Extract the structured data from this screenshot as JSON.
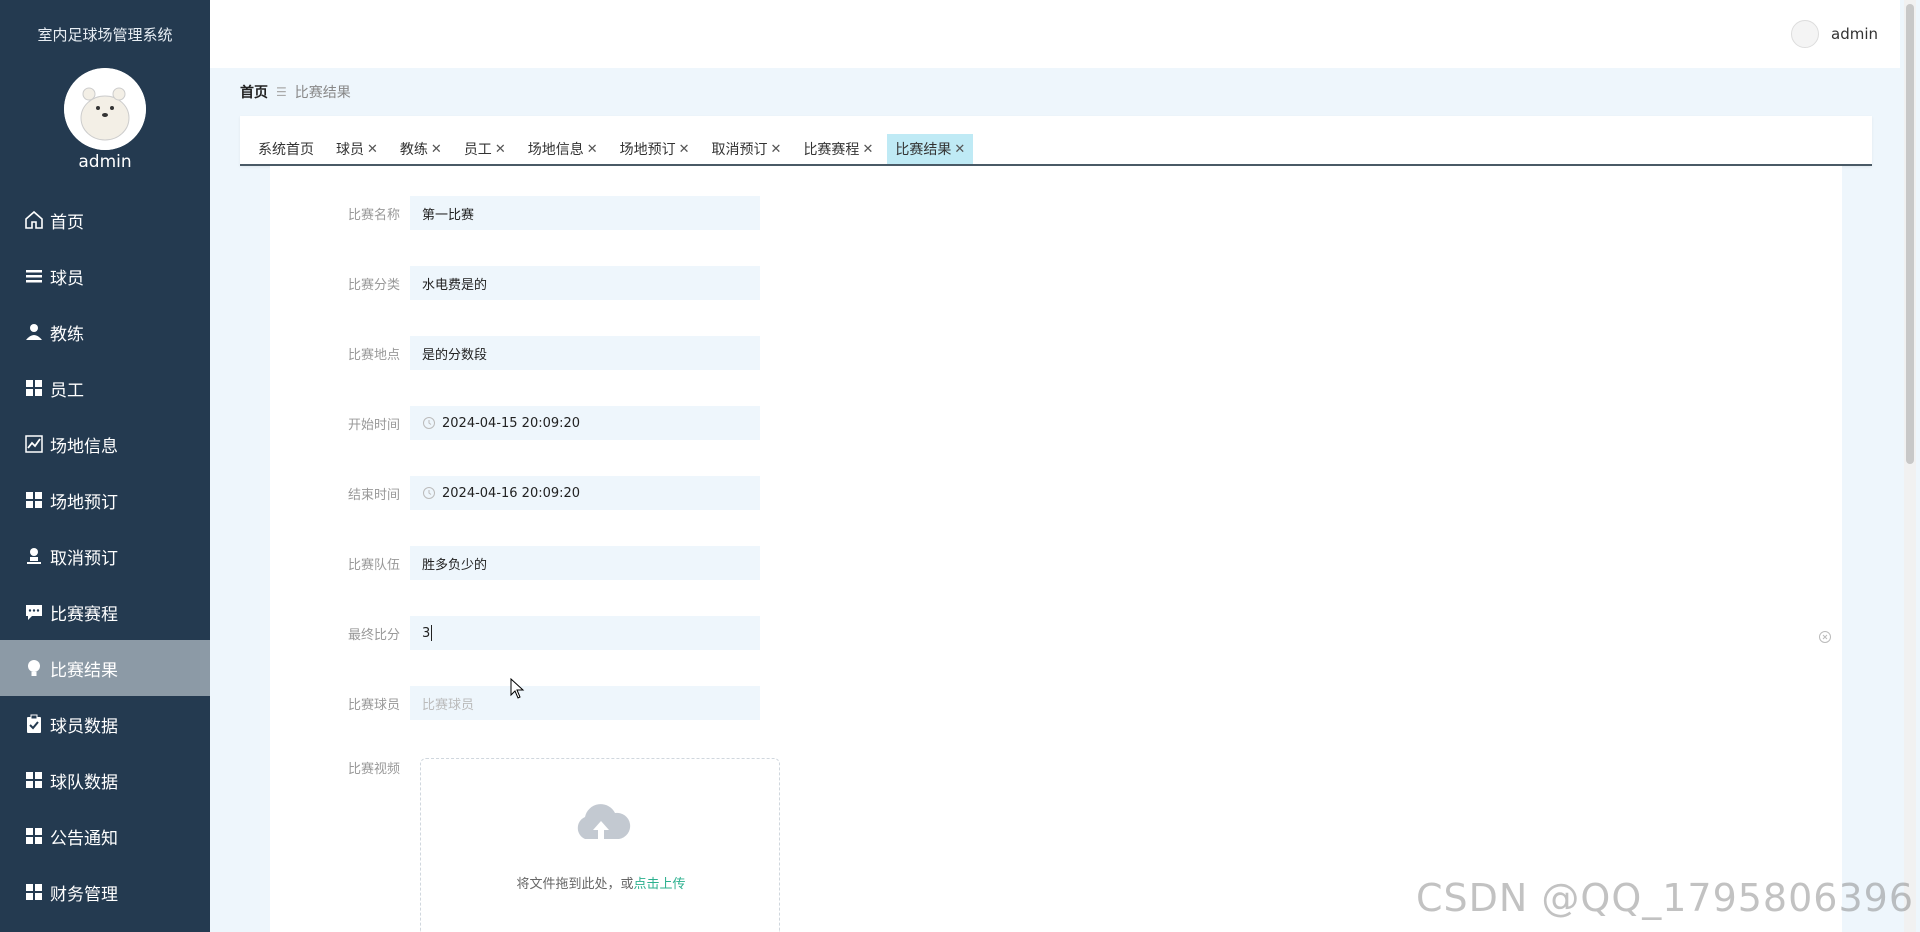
{
  "app": {
    "title": "室内足球场管理系统",
    "user": "admin"
  },
  "header": {
    "user_name": "admin"
  },
  "sidebar": {
    "items": [
      {
        "label": "首页",
        "icon": "home-icon"
      },
      {
        "label": "球员",
        "icon": "list-icon"
      },
      {
        "label": "教练",
        "icon": "user-icon"
      },
      {
        "label": "员工",
        "icon": "grid-icon"
      },
      {
        "label": "场地信息",
        "icon": "chart-icon"
      },
      {
        "label": "场地预订",
        "icon": "grid-icon"
      },
      {
        "label": "取消预订",
        "icon": "person-stamp-icon"
      },
      {
        "label": "比赛赛程",
        "icon": "comment-icon"
      },
      {
        "label": "比赛结果",
        "icon": "bulb-icon"
      },
      {
        "label": "球员数据",
        "icon": "clipboard-icon"
      },
      {
        "label": "球队数据",
        "icon": "grid-icon"
      },
      {
        "label": "公告通知",
        "icon": "grid-icon"
      },
      {
        "label": "财务管理",
        "icon": "grid-icon"
      }
    ],
    "active_index": 8
  },
  "breadcrumb": {
    "home": "首页",
    "separator": "☰",
    "current": "比赛结果"
  },
  "tabs": [
    {
      "label": "系统首页",
      "closable": false
    },
    {
      "label": "球员",
      "closable": true
    },
    {
      "label": "教练",
      "closable": true
    },
    {
      "label": "员工",
      "closable": true
    },
    {
      "label": "场地信息",
      "closable": true
    },
    {
      "label": "场地预订",
      "closable": true
    },
    {
      "label": "取消预订",
      "closable": true
    },
    {
      "label": "比赛赛程",
      "closable": true
    },
    {
      "label": "比赛结果",
      "closable": true,
      "active": true
    }
  ],
  "form": {
    "match_name": {
      "label": "比赛名称",
      "value": "第一比赛"
    },
    "match_category": {
      "label": "比赛分类",
      "value": "水电费是的"
    },
    "match_location": {
      "label": "比赛地点",
      "value": "是的分数段"
    },
    "start_time": {
      "label": "开始时间",
      "value": "2024-04-15 20:09:20"
    },
    "end_time": {
      "label": "结束时间",
      "value": "2024-04-16 20:09:20"
    },
    "match_teams": {
      "label": "比赛队伍",
      "value": "胜多负少的"
    },
    "final_score": {
      "label": "最终比分",
      "value": "3"
    },
    "match_players": {
      "label": "比赛球员",
      "placeholder": "比赛球员"
    },
    "match_video": {
      "label": "比赛视频",
      "upload_text": "将文件拖到此处，或",
      "upload_link": "点击上传"
    }
  },
  "watermark": "CSDN @QQ_1795806396",
  "colors": {
    "sidebar_bg": "#243a50",
    "active_tab_bg": "#bfeaf5",
    "link": "#2bb08e"
  }
}
